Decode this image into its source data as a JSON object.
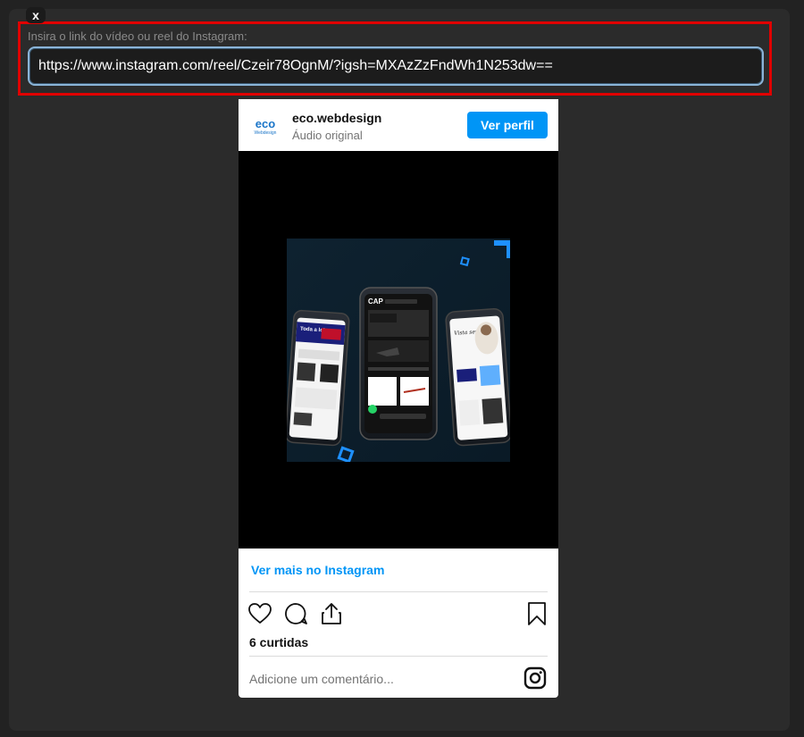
{
  "modal": {
    "close_label": "x"
  },
  "link_form": {
    "label": "Insira o link do vídeo ou reel do Instagram:",
    "value": "https://www.instagram.com/reel/Czeir78OgnM/?igsh=MXAzZzFndWh1N253dw=="
  },
  "embed": {
    "username": "eco.webdesign",
    "audio": "Áudio original",
    "profile_button": "Ver perfil",
    "logo_text": "eco",
    "logo_subtext": "Webdesign",
    "more_link": "Ver mais no Instagram",
    "likes": "6 curtidas",
    "comment_placeholder": "Adicione um comentário...",
    "thumbnail_texts": {
      "left_phone": "Toda a loja",
      "center_phone": "CAP",
      "right_phone": "Vista seu pet"
    }
  },
  "colors": {
    "accent_blue": "#0095f6",
    "highlight_red": "#e00000",
    "modal_bg": "#2b2b2b",
    "page_bg": "#222222"
  },
  "icons": {
    "close": "close-icon",
    "like": "heart-icon",
    "comment": "comment-icon",
    "share": "share-icon",
    "save": "bookmark-icon",
    "instagram": "instagram-icon"
  }
}
